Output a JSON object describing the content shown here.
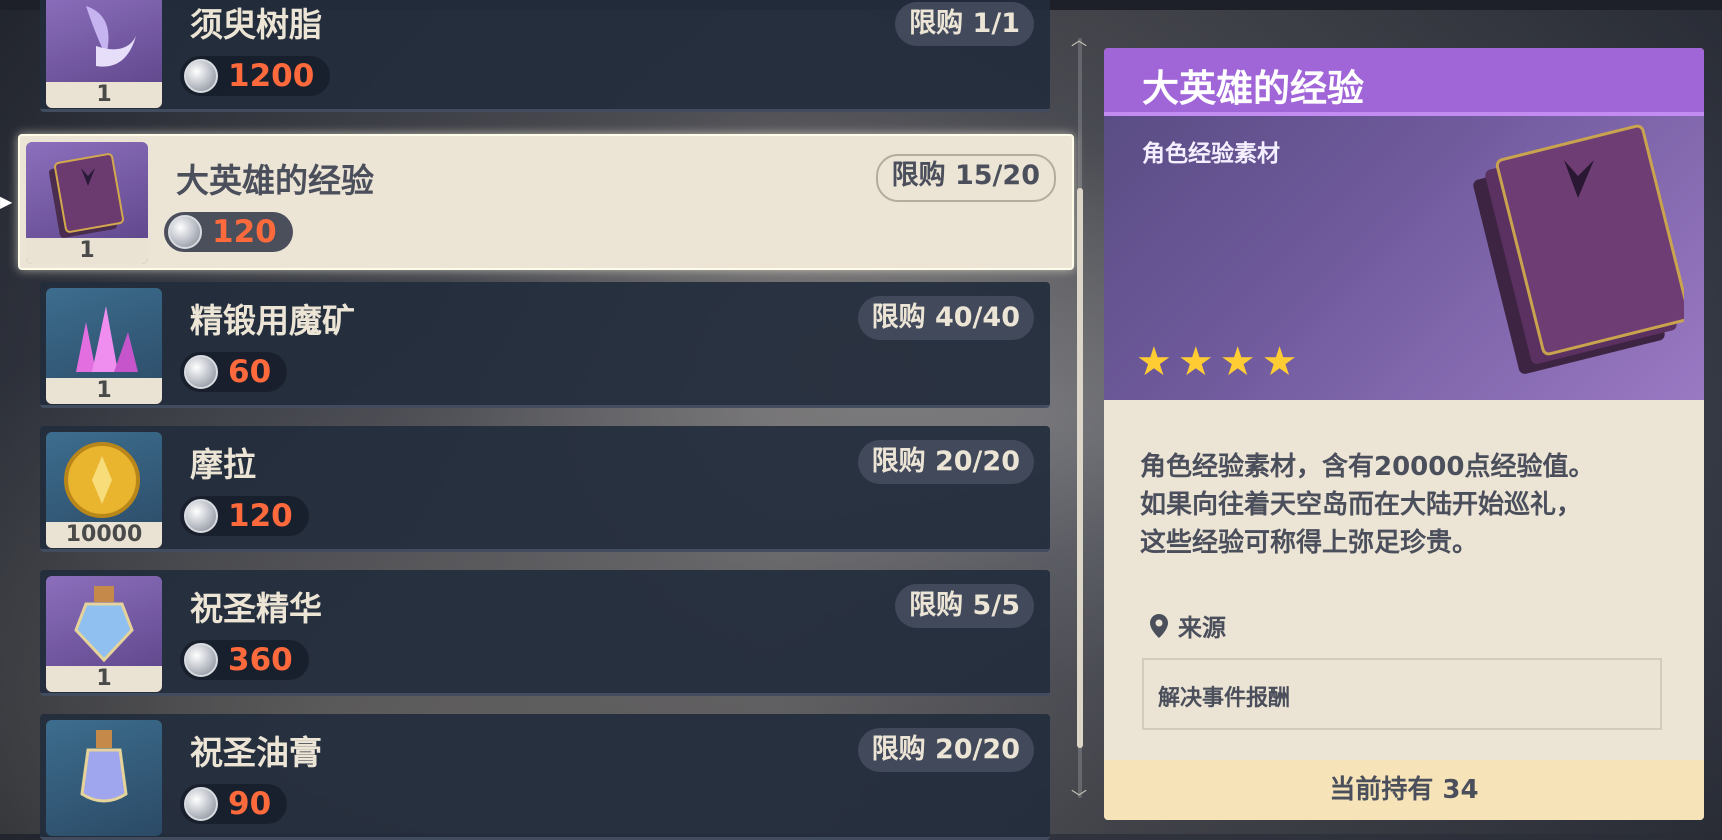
{
  "shop": {
    "items": [
      {
        "name": "须臾树脂",
        "limit": "限购 1/1",
        "price": "1200",
        "count": "1",
        "icon": "resin-icon"
      },
      {
        "name": "大英雄的经验",
        "limit": "限购 15/20",
        "price": "120",
        "count": "1",
        "icon": "book-icon",
        "selected": true
      },
      {
        "name": "精锻用魔矿",
        "limit": "限购 40/40",
        "price": "60",
        "count": "1",
        "icon": "crystal-icon"
      },
      {
        "name": "摩拉",
        "limit": "限购 20/20",
        "price": "120",
        "count": "10000",
        "icon": "mora-coin-icon"
      },
      {
        "name": "祝圣精华",
        "limit": "限购 5/5",
        "price": "360",
        "count": "1",
        "icon": "essence-bottle-icon"
      },
      {
        "name": "祝圣油膏",
        "limit": "限购 20/20",
        "price": "90",
        "count": "",
        "icon": "oil-bottle-icon"
      }
    ],
    "currency_icon": "silver-coin-icon"
  },
  "detail": {
    "title": "大英雄的经验",
    "category": "角色经验素材",
    "rarity": 4,
    "description": [
      "角色经验素材，含有20000点经验值。",
      "如果向往着天空岛而在大陆开始巡礼，",
      "这些经验可称得上弥足珍贵。"
    ],
    "source_label": "来源",
    "source": "解决事件报酬",
    "owned": "当前持有 34"
  },
  "colors": {
    "price": "#ff6a3d",
    "title_bar": "#a066d8",
    "star": "#ffcc33",
    "selected_bg": "#ece5d6"
  }
}
